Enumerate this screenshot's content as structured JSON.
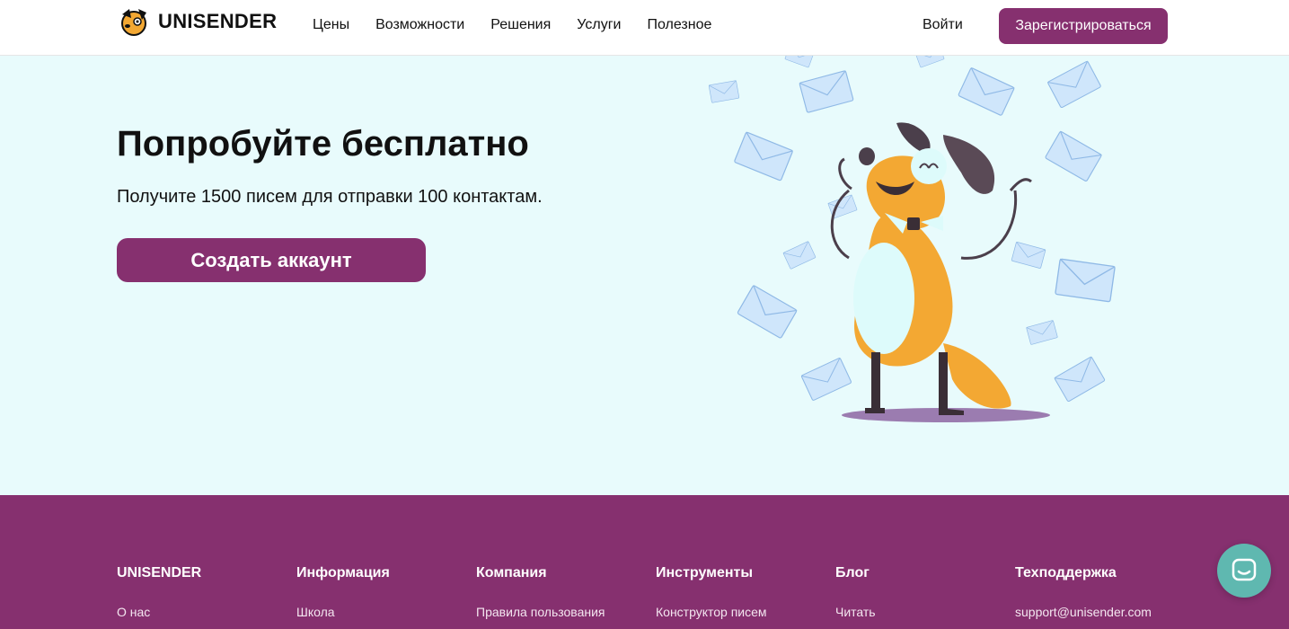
{
  "header": {
    "logo_text": "UNISENDER",
    "nav": [
      "Цены",
      "Возможности",
      "Решения",
      "Услуги",
      "Полезное"
    ],
    "login_label": "Войти",
    "signup_label": "Зарегистрироваться"
  },
  "hero": {
    "title": "Попробуйте бесплатно",
    "subtitle": "Получите 1500 писем для отправки 100 контактам.",
    "cta_label": "Создать аккаунт"
  },
  "footer": {
    "columns": [
      {
        "title": "UNISENDER",
        "link": "О нас"
      },
      {
        "title": "Информация",
        "link": "Школа"
      },
      {
        "title": "Компания",
        "link": "Правила пользования"
      },
      {
        "title": "Инструменты",
        "link": "Конструктор писем"
      },
      {
        "title": "Блог",
        "link": "Читать"
      },
      {
        "title": "Техподдержка",
        "link": "support@unisender.com"
      }
    ]
  },
  "icons": {
    "logo": "dog-logo-icon",
    "chat": "chat-bubble-icon",
    "illustration": "happy-dog-with-envelopes-illustration"
  },
  "colors": {
    "brand": "#86306f",
    "hero_bg": "#e8fbfc",
    "chat": "#5fb8b0",
    "dog": "#f3a833"
  }
}
